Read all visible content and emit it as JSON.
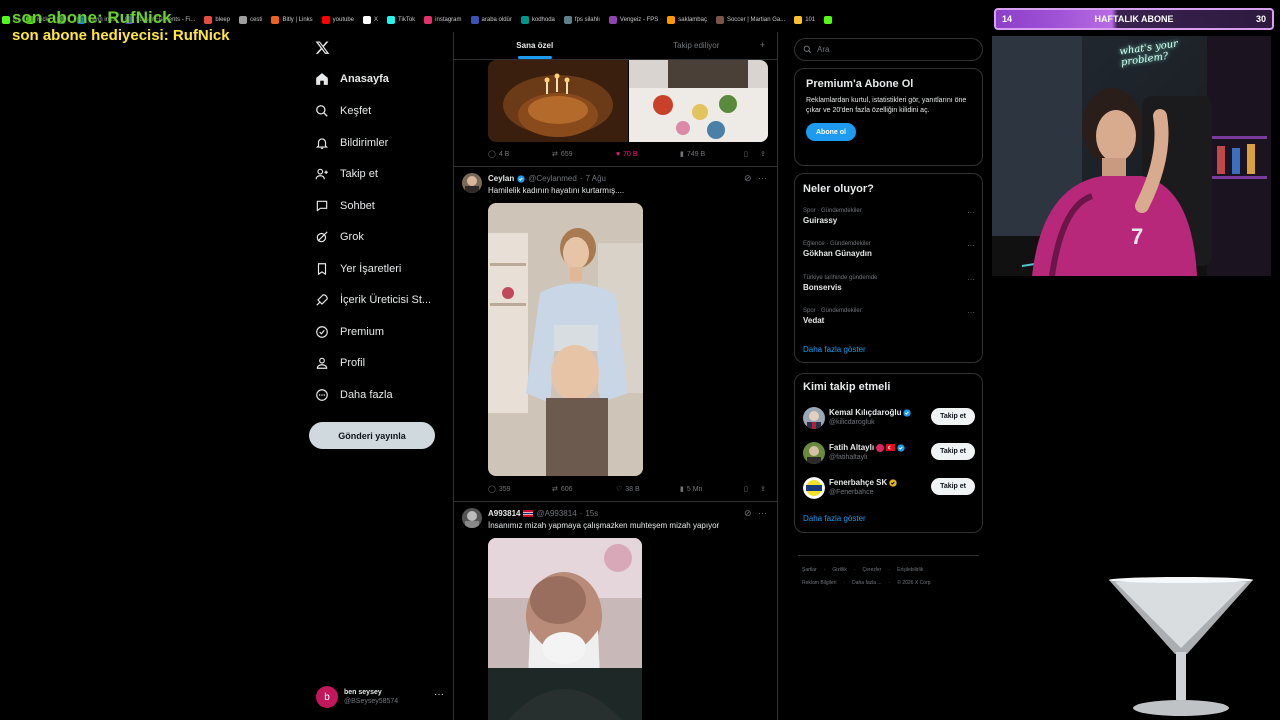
{
  "browser": {
    "bookmarks": [
      {
        "label": "K",
        "icon": "kick-icon",
        "color": "#53fc18"
      },
      {
        "label": "Kick",
        "icon": "kick-icon",
        "color": "#53fc18"
      },
      {
        "label": "",
        "icon": "globe-icon",
        "color": "#4caf50"
      },
      {
        "label": "yayın indir",
        "icon": "download-icon",
        "color": "#2196f3"
      },
      {
        "label": "StreamElements - Fi...",
        "icon": "streamelements-icon",
        "color": "#6c5ce7"
      },
      {
        "label": "bleep",
        "icon": "bleep-icon",
        "color": "#e74c3c"
      },
      {
        "label": "cesti",
        "icon": "cesti-icon",
        "color": "#9e9e9e"
      },
      {
        "label": "Bitly | Links",
        "icon": "bitly-icon",
        "color": "#ee6123"
      },
      {
        "label": "youtube",
        "icon": "youtube-icon",
        "color": "#ff0000"
      },
      {
        "label": "X",
        "icon": "x-icon",
        "color": "#ffffff"
      },
      {
        "label": "TikTok",
        "icon": "tiktok-icon",
        "color": "#25f4ee"
      },
      {
        "label": "instagram",
        "icon": "instagram-icon",
        "color": "#e1306c"
      },
      {
        "label": "araba oldür",
        "icon": "car-icon",
        "color": "#3f51b5"
      },
      {
        "label": "kodhoda",
        "icon": "kodhoda-icon",
        "color": "#009688"
      },
      {
        "label": "fps silahlı",
        "icon": "fps-icon",
        "color": "#607d8b"
      },
      {
        "label": "Vengeiz - FPS",
        "icon": "vengeiz-icon",
        "color": "#8e44ad"
      },
      {
        "label": "saklambaç",
        "icon": "saklambac-icon",
        "color": "#ff9800"
      },
      {
        "label": "Soccer | Martian Ga...",
        "icon": "soccer-icon",
        "color": "#795548"
      },
      {
        "label": "101",
        "icon": "okey-icon",
        "color": "#fbc02d"
      },
      {
        "label": "",
        "icon": "kick-icon",
        "color": "#53fc18"
      }
    ]
  },
  "overlay": {
    "last_sub": "son abone: RufNick",
    "last_gifter": "son abone hediyecisi: RufNick"
  },
  "x": {
    "nav": {
      "items": [
        "Anasayfa",
        "Keşfet",
        "Bildirimler",
        "Takip et",
        "Sohbet",
        "Grok",
        "Yer İşaretleri",
        "İçerik Üreticisi St...",
        "Premium",
        "Profil",
        "Daha fazla"
      ],
      "post_button": "Gönderi yayınla"
    },
    "account": {
      "initial": "b",
      "name": "ben seysey",
      "handle": "@BSeysey58574"
    },
    "tabs": [
      "Sana özel",
      "Takip ediliyor"
    ],
    "tweets": [
      {
        "actions": {
          "replies": "4 B",
          "retweets": "659",
          "likes": "70 B",
          "views": "749 B"
        }
      },
      {
        "name": "Ceylan",
        "handle": "@Ceylanmed",
        "time": "7 Ağu",
        "text": "Hamilelik kadının hayatını kurtarmış....",
        "actions": {
          "replies": "359",
          "retweets": "606",
          "likes": "38 B",
          "views": "5 Mn"
        }
      },
      {
        "name": "A993814",
        "handle": "@A993814",
        "time": "15s",
        "text": "İnsanımız mizah yapmaya çalışmazken muhteşem mizah yapıyor"
      }
    ],
    "search": {
      "placeholder": "Ara"
    },
    "premium": {
      "title": "Premium'a Abone Ol",
      "text": "Reklamlardan kurtul, istatistikleri gör, yanıtlarını öne çıkar ve 20'den fazla özelliğin kilidini aç.",
      "button": "Abone ol"
    },
    "trends": {
      "title": "Neler oluyor?",
      "items": [
        {
          "category": "Spor · Gündemdekiler",
          "name": "Guirassy"
        },
        {
          "category": "Eğlence · Gündemdekiler",
          "name": "Gökhan Günaydın"
        },
        {
          "category": "Türkiye tarihinde gündemde",
          "name": "Bonservis"
        },
        {
          "category": "Spor · Gündemdekiler",
          "name": "Vedat"
        }
      ],
      "show_more": "Daha fazla göster"
    },
    "who_to_follow": {
      "title": "Kimi takip etmeli",
      "items": [
        {
          "name": "Kemal Kılıçdaroğlu",
          "handle": "@kilicdarogluk",
          "button": "Takip et"
        },
        {
          "name": "Fatih Altaylı",
          "handle": "@fatihaltayli",
          "button": "Takip et"
        },
        {
          "name": "Fenerbahçe SK",
          "handle": "@Fenerbahce",
          "button": "Takip et"
        }
      ],
      "show_more": "Daha fazla göster"
    },
    "footer": {
      "row1": [
        "Şartlar",
        "Gizlilik",
        "Çerezler",
        "Erişilebilirlik"
      ],
      "row2": [
        "Reklam Bilgileri",
        "Daha fazla ...",
        "© 2026 X Corp."
      ]
    }
  },
  "stream": {
    "weekly_sub": {
      "label": "HAFTALIK ABONE",
      "current": "14",
      "goal": "30"
    },
    "neon_sign": "what's your problem?"
  },
  "colors": {
    "accent": "#1d9bf0",
    "like": "#f91880",
    "overlay_green": "#6bd12f",
    "overlay_yellow": "#ffe640",
    "sub_bar": "#a052d6"
  }
}
